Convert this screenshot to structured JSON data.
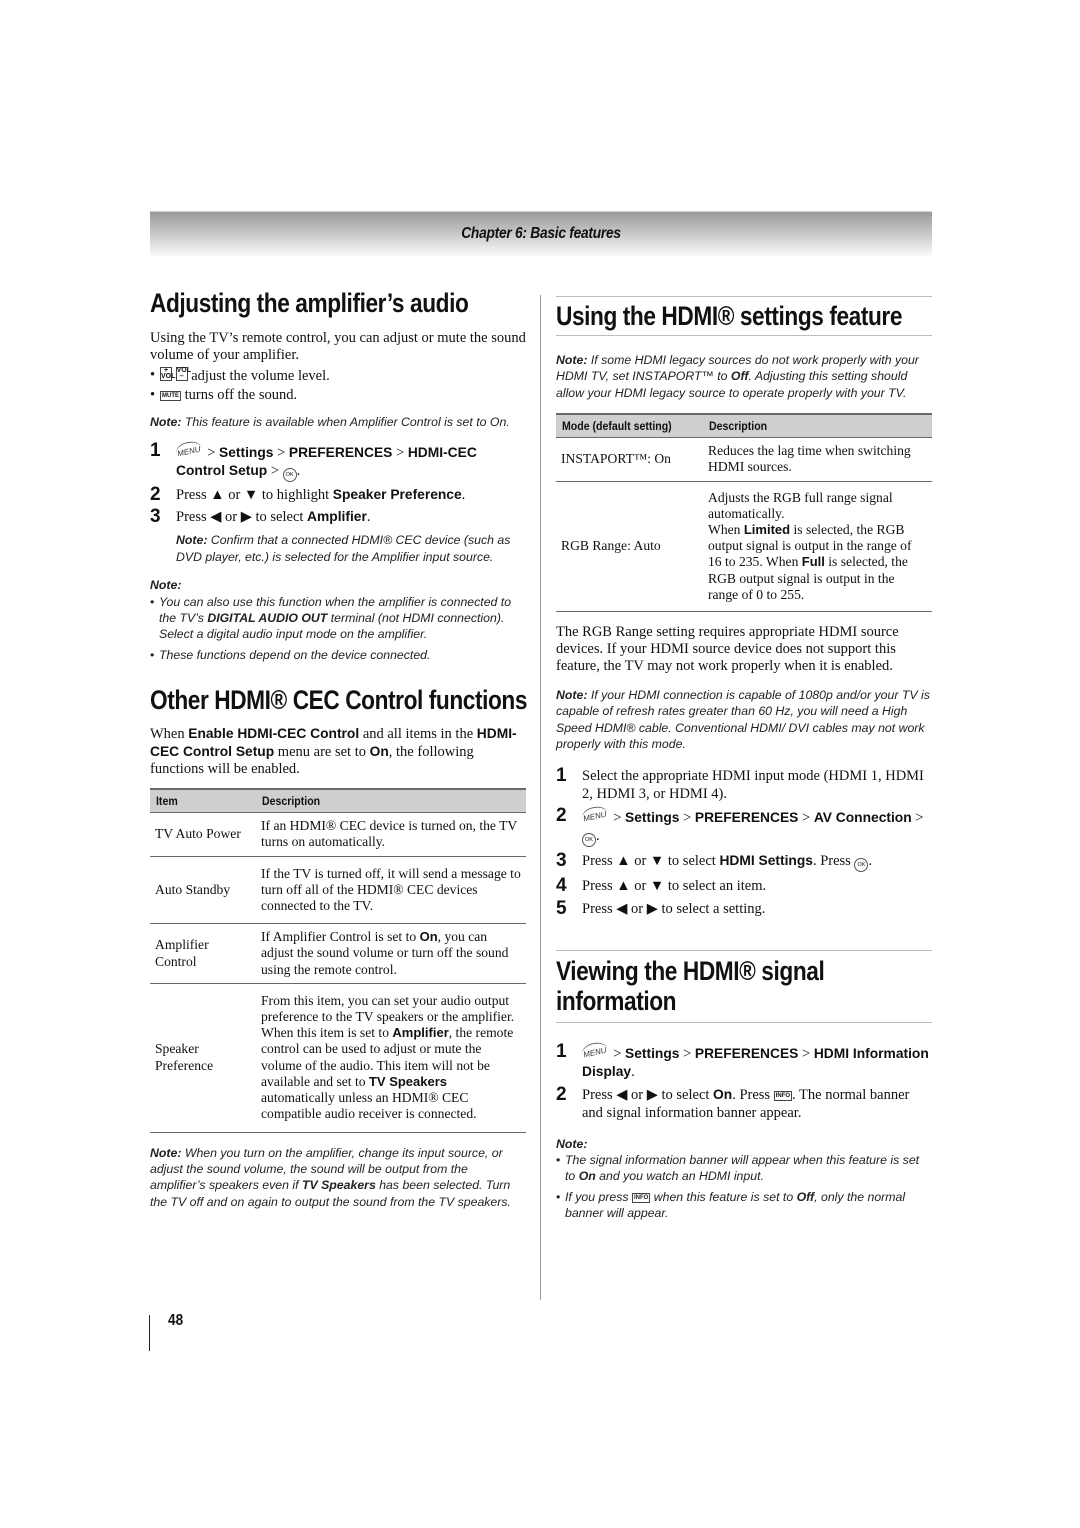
{
  "chapter": {
    "title": "Chapter 6: Basic features"
  },
  "page_number": "48",
  "left": {
    "amp_section": {
      "heading": "Adjusting the amplifier’s audio",
      "intro": "Using the TV’s remote control, you can adjust or mute the sound volume of your amplifier.",
      "bullets": [
        {
          "icons": [
            "vol-up-key",
            "vol-down-key"
          ],
          "key_labels": [
            "+ VOL",
            "VOL –"
          ],
          "text": "adjust the volume level."
        },
        {
          "icons": [
            "mute-key"
          ],
          "key_labels": [
            "MUTE"
          ],
          "text": "turns off the sound."
        }
      ],
      "note_label": "Note:",
      "note_text": "This feature is available when Amplifier Control is set to On.",
      "steps": [
        {
          "num": "1",
          "menu_label": "MENU",
          "sep": ">",
          "path": [
            "Settings",
            "PREFERENCES",
            "HDMI-CEC Control Setup"
          ],
          "ok_label": "OK",
          "end": "."
        },
        {
          "num": "2",
          "pre": "Press ▲ or ▼ to highlight ",
          "bold": "Speaker Preference",
          "post": "."
        },
        {
          "num": "3",
          "pre": "Press ◀ or ▶ to select ",
          "bold": "Amplifier",
          "post": "."
        }
      ],
      "step_note_label": "Note:",
      "step_note_text": "Confirm that a connected HDMI® CEC device (such as DVD player, etc.) is selected for the Amplifier input source.",
      "notes_label": "Note:",
      "notes": [
        {
          "pre": "You can also use this function when the amplifier is connected to the TV’s ",
          "bold": "DIGITAL AUDIO OUT",
          "post": " terminal (not HDMI connection). Select a digital audio input mode on the amplifier."
        },
        {
          "pre": "These functions depend on the device connected.",
          "bold": "",
          "post": ""
        }
      ]
    },
    "cec_section": {
      "heading": "Other HDMI® CEC Control functions",
      "intro": {
        "p1": "When ",
        "b1": "Enable HDMI-CEC Control",
        "p2": " and all items in the ",
        "b2": "HDMI-CEC Control Setup",
        "p3": " menu are set to ",
        "b3": "On",
        "p4": ", the following functions will be enabled."
      },
      "table": {
        "headers": [
          "Item",
          "Description"
        ],
        "rows": [
          {
            "item": "TV Auto Power",
            "desc_pre": "If an HDMI® CEC device is turned on, the TV turns on automatically.",
            "desc_bold": "",
            "desc_post": ""
          },
          {
            "item": "Auto Standby",
            "desc_pre": "If the TV is turned off, it will send a message to turn off all of the HDMI® CEC devices connected to the TV.",
            "desc_bold": "",
            "desc_post": ""
          },
          {
            "item": "Amplifier Control",
            "desc_pre": "If Amplifier Control is set to ",
            "desc_bold": "On",
            "desc_post": ", you can adjust the sound volume or turn off the sound using the remote control."
          },
          {
            "item": "Speaker Preference",
            "desc_pre": "From this item, you can set your audio output preference to the TV speakers or the amplifier. When this item is set to ",
            "desc_bold": "Amplifier",
            "desc_post": ", the remote control can be used to adjust or mute the volume of the audio. This item will not be available and set to ",
            "desc_bold2": "TV Speakers",
            "desc_post2": " automatically unless an HDMI® CEC compatible audio receiver is connected."
          }
        ]
      },
      "note_label": "Note:",
      "note_pre": "When you turn on the amplifier, change its input source, or adjust the sound volume, the sound will be output from the amplifier’s speakers even if ",
      "note_bold": "TV Speakers",
      "note_post": " has been selected. Turn the TV off and on again to output the sound from the TV speakers."
    }
  },
  "right": {
    "settings_section": {
      "heading": "Using the HDMI® settings feature",
      "note_label": "Note:",
      "note_pre": "If some HDMI legacy sources do not work properly with your HDMI TV, set INSTAPORT™ to ",
      "note_bold": "Off",
      "note_post": ". Adjusting this setting should allow your HDMI legacy source to operate properly with your TV.",
      "table": {
        "headers": [
          "Mode (default setting)",
          "Description"
        ],
        "rows": [
          {
            "mode": "INSTAPORT™: On",
            "desc": "Reduces the lag time when switching HDMI sources."
          },
          {
            "mode": "RGB Range: Auto",
            "desc_a": "Adjusts the RGB full range signal automatically.",
            "desc_b1": "When ",
            "desc_b_bold": "Limited",
            "desc_b2": " is selected, the RGB output signal is output in the range of 16 to 235. When ",
            "desc_c_bold": "Full",
            "desc_c2": " is selected, the RGB output signal is output in the range of 0 to 255."
          }
        ]
      },
      "rgb_paragraph": "The RGB Range setting requires appropriate HDMI source devices. If your HDMI source device does not support this feature, the TV may not work properly when it is enabled.",
      "note2_label": "Note:",
      "note2_text": "If your HDMI connection is capable of 1080p and/or your TV is capable of refresh rates greater than 60 Hz, you will need a High Speed HDMI® cable. Conventional HDMI/ DVI cables may not work properly with this mode.",
      "steps": [
        {
          "num": "1",
          "text": "Select the appropriate HDMI input mode (HDMI 1, HDMI 2, HDMI 3, or HDMI 4)."
        },
        {
          "num": "2",
          "menu_label": "MENU",
          "sep": ">",
          "path": [
            "Settings",
            "PREFERENCES",
            "AV Connection"
          ],
          "ok_label": "OK",
          "end": "."
        },
        {
          "num": "3",
          "pre": "Press ▲ or ▼ to select ",
          "bold": "HDMI Settings",
          "post": ". Press ",
          "ok_label": "OK",
          "end": "."
        },
        {
          "num": "4",
          "text": "Press ▲ or ▼ to select an item."
        },
        {
          "num": "5",
          "text": "Press ◀ or ▶ to select a setting."
        }
      ]
    },
    "signal_section": {
      "heading_line1": "Viewing the HDMI® signal",
      "heading_line2": "information",
      "steps": [
        {
          "num": "1",
          "menu_label": "MENU",
          "sep": ">",
          "path": [
            "Settings",
            "PREFERENCES",
            "HDMI Information Display"
          ],
          "end": "."
        },
        {
          "num": "2",
          "pre": "Press ◀ or ▶ to select ",
          "bold": "On",
          "mid": ". Press ",
          "info_label": "INFO",
          "post": ". The normal banner and signal information banner appear."
        }
      ],
      "notes_label": "Note:",
      "notes": [
        {
          "pre": "The signal information banner will appear when this feature is set to ",
          "bold": "On",
          "post": " and you watch an HDMI input."
        },
        {
          "pre": "If you press ",
          "info_label": "INFO",
          "mid": " when this feature is set to ",
          "bold": "Off",
          "post": ", only the normal banner will appear."
        }
      ]
    }
  }
}
